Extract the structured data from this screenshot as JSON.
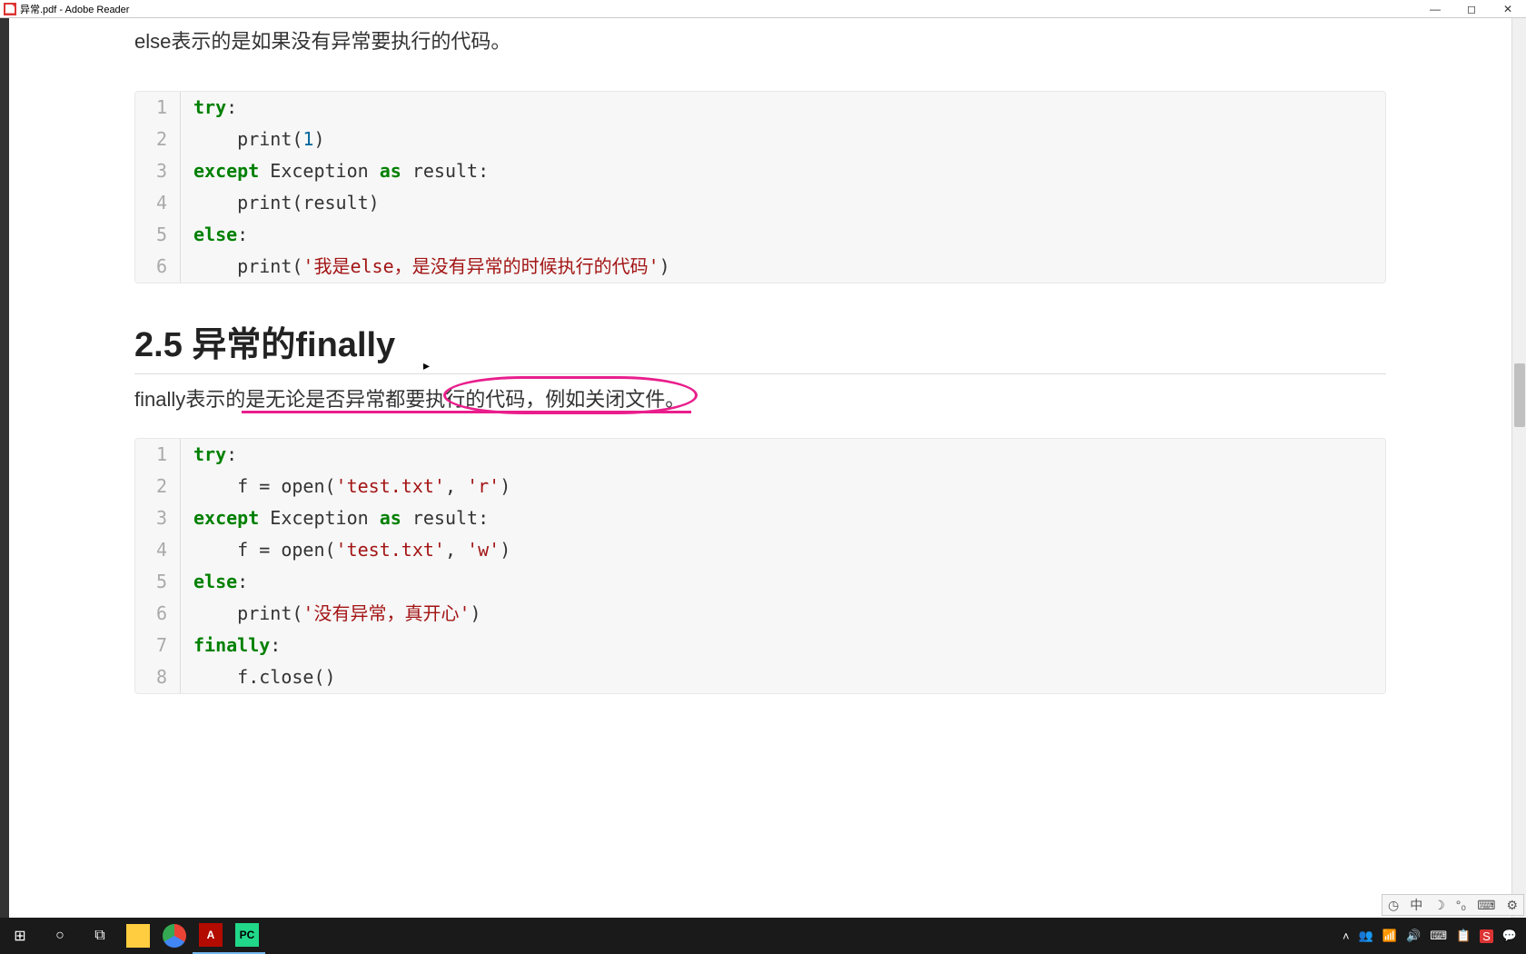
{
  "window": {
    "title": "异常.pdf - Adobe Reader",
    "minimize": "—",
    "maximize": "◻",
    "close": "✕"
  },
  "content": {
    "intro_line": "else表示的是如果没有异常要执行的代码。",
    "section_heading": "2.5 异常的finally",
    "body_line": "finally表示的是无论是否异常都要执行的代码，例如关闭文件。",
    "code_block_1": {
      "lines": [
        {
          "n": "1",
          "tokens": [
            {
              "t": "try",
              "c": "kw"
            },
            {
              "t": ":",
              "c": "id"
            }
          ]
        },
        {
          "n": "2",
          "tokens": [
            {
              "t": "    print",
              "c": "fn"
            },
            {
              "t": "(",
              "c": "id"
            },
            {
              "t": "1",
              "c": "num"
            },
            {
              "t": ")",
              "c": "id"
            }
          ]
        },
        {
          "n": "3",
          "tokens": [
            {
              "t": "except",
              "c": "kw"
            },
            {
              "t": " Exception ",
              "c": "id"
            },
            {
              "t": "as",
              "c": "kw"
            },
            {
              "t": " result:",
              "c": "id"
            }
          ]
        },
        {
          "n": "4",
          "tokens": [
            {
              "t": "    print",
              "c": "fn"
            },
            {
              "t": "(result)",
              "c": "id"
            }
          ]
        },
        {
          "n": "5",
          "tokens": [
            {
              "t": "else",
              "c": "kw"
            },
            {
              "t": ":",
              "c": "id"
            }
          ]
        },
        {
          "n": "6",
          "tokens": [
            {
              "t": "    print",
              "c": "fn"
            },
            {
              "t": "(",
              "c": "id"
            },
            {
              "t": "'我是else，是没有异常的时候执行的代码'",
              "c": "str"
            },
            {
              "t": ")",
              "c": "id"
            }
          ]
        }
      ]
    },
    "code_block_2": {
      "lines": [
        {
          "n": "1",
          "tokens": [
            {
              "t": "try",
              "c": "kw"
            },
            {
              "t": ":",
              "c": "id"
            }
          ]
        },
        {
          "n": "2",
          "tokens": [
            {
              "t": "    f = open(",
              "c": "id"
            },
            {
              "t": "'test.txt'",
              "c": "str"
            },
            {
              "t": ", ",
              "c": "id"
            },
            {
              "t": "'r'",
              "c": "str"
            },
            {
              "t": ")",
              "c": "id"
            }
          ]
        },
        {
          "n": "3",
          "tokens": [
            {
              "t": "except",
              "c": "kw"
            },
            {
              "t": " Exception ",
              "c": "id"
            },
            {
              "t": "as",
              "c": "kw"
            },
            {
              "t": " result:",
              "c": "id"
            }
          ]
        },
        {
          "n": "4",
          "tokens": [
            {
              "t": "    f = open(",
              "c": "id"
            },
            {
              "t": "'test.txt'",
              "c": "str"
            },
            {
              "t": ", ",
              "c": "id"
            },
            {
              "t": "'w'",
              "c": "str"
            },
            {
              "t": ")",
              "c": "id"
            }
          ]
        },
        {
          "n": "5",
          "tokens": [
            {
              "t": "else",
              "c": "kw"
            },
            {
              "t": ":",
              "c": "id"
            }
          ]
        },
        {
          "n": "6",
          "tokens": [
            {
              "t": "    print",
              "c": "fn"
            },
            {
              "t": "(",
              "c": "id"
            },
            {
              "t": "'没有异常，真开心'",
              "c": "str"
            },
            {
              "t": ")",
              "c": "id"
            }
          ]
        },
        {
          "n": "7",
          "tokens": [
            {
              "t": "finally",
              "c": "kw"
            },
            {
              "t": ":",
              "c": "id"
            }
          ]
        },
        {
          "n": "8",
          "tokens": [
            {
              "t": "    f.close()",
              "c": "id"
            }
          ]
        }
      ]
    }
  },
  "widgets": {
    "clock": "◷",
    "ime": "中",
    "moon": "☽",
    "temp": "°₀",
    "keyboard": "⌨",
    "gear": "⚙"
  },
  "taskbar": {
    "start": "⊞",
    "cortana": "○",
    "taskview": "⧉",
    "apps": [
      "folder",
      "chrome",
      "adobe",
      "pycharm"
    ]
  },
  "tray": {
    "chevron": "˄",
    "people": "👥",
    "net": "📶",
    "vol": "🔊",
    "ime": "⌨",
    "ime2": "📋",
    "sogou": "S",
    "action": "💬"
  }
}
